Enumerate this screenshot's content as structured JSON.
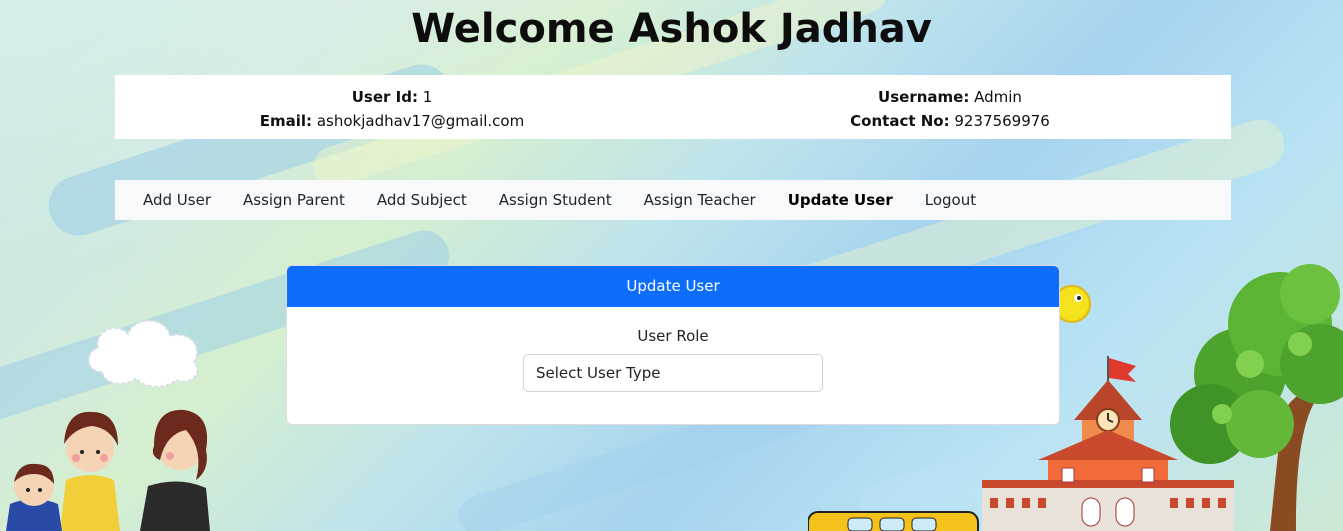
{
  "header": {
    "title": "Welcome Ashok Jadhav"
  },
  "user_info": {
    "user_id_label": "User Id:",
    "user_id_value": "1",
    "email_label": "Email:",
    "email_value": "ashokjadhav17@gmail.com",
    "username_label": "Username:",
    "username_value": "Admin",
    "contact_label": "Contact No:",
    "contact_value": "9237569976"
  },
  "nav": {
    "items": [
      {
        "label": "Add User"
      },
      {
        "label": "Assign Parent"
      },
      {
        "label": "Add Subject"
      },
      {
        "label": "Assign Student"
      },
      {
        "label": "Assign Teacher"
      },
      {
        "label": "Update User",
        "active": true
      },
      {
        "label": "Logout"
      }
    ]
  },
  "form": {
    "header": "Update User",
    "role_label": "User Role",
    "role_select_value": "Select User Type"
  },
  "colors": {
    "primary": "#0d6efd",
    "nav_bg": "#f8f9fa"
  }
}
